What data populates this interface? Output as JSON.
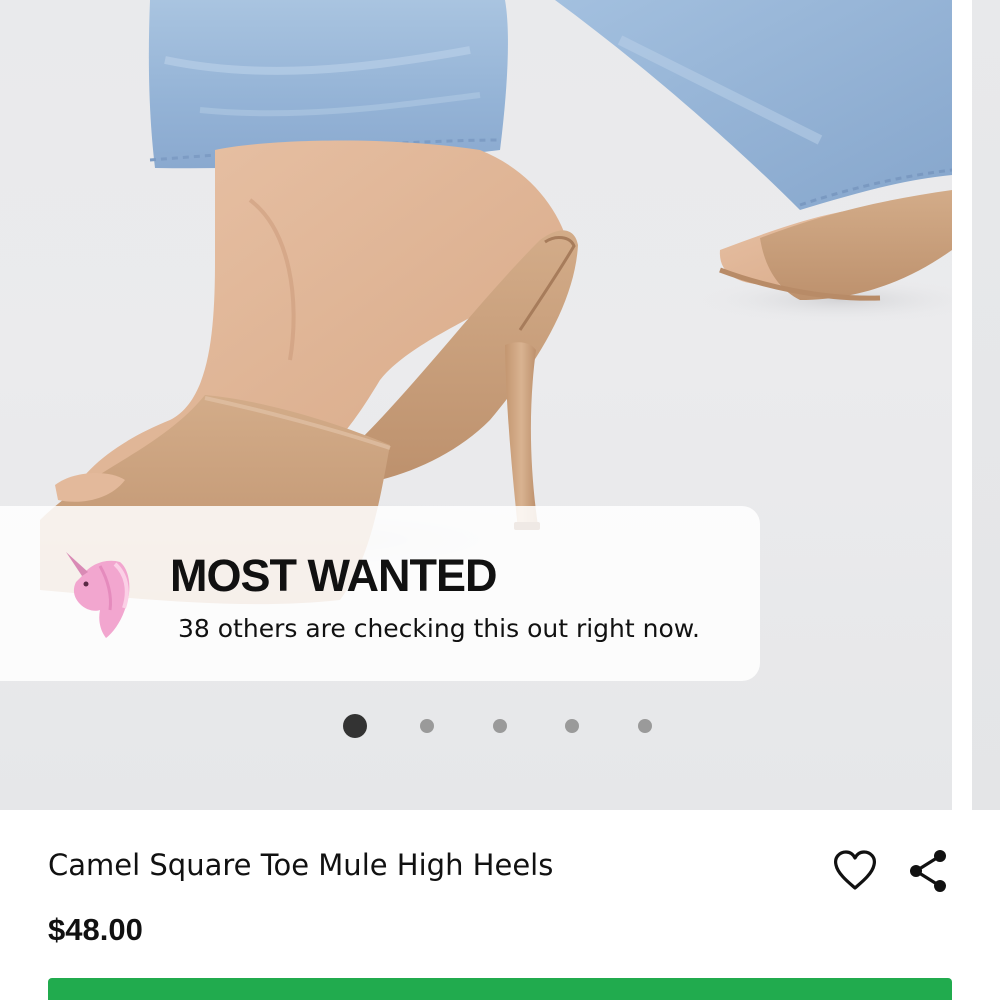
{
  "gallery": {
    "slide_count": 5,
    "active_index": 0,
    "image_subject": "camel-square-toe-mule-high-heel-worn-with-light-blue-jeans"
  },
  "toast": {
    "title": "MOST WANTED",
    "subtitle": "38 others are checking this out right now.",
    "icon": "unicorn-icon"
  },
  "product": {
    "name": "Camel Square Toe Mule High Heels",
    "price": "$48.00"
  },
  "actions": {
    "wishlist_icon": "heart-outline-icon",
    "share_icon": "share-icon",
    "add_to_bag_label": ""
  },
  "colors": {
    "accent_green": "#21ab4e",
    "text": "#111111",
    "dot_active": "#333333",
    "dot_inactive": "#9a9a9a",
    "shoe_camel": "#c9a07c",
    "denim": "#9dbad8"
  }
}
